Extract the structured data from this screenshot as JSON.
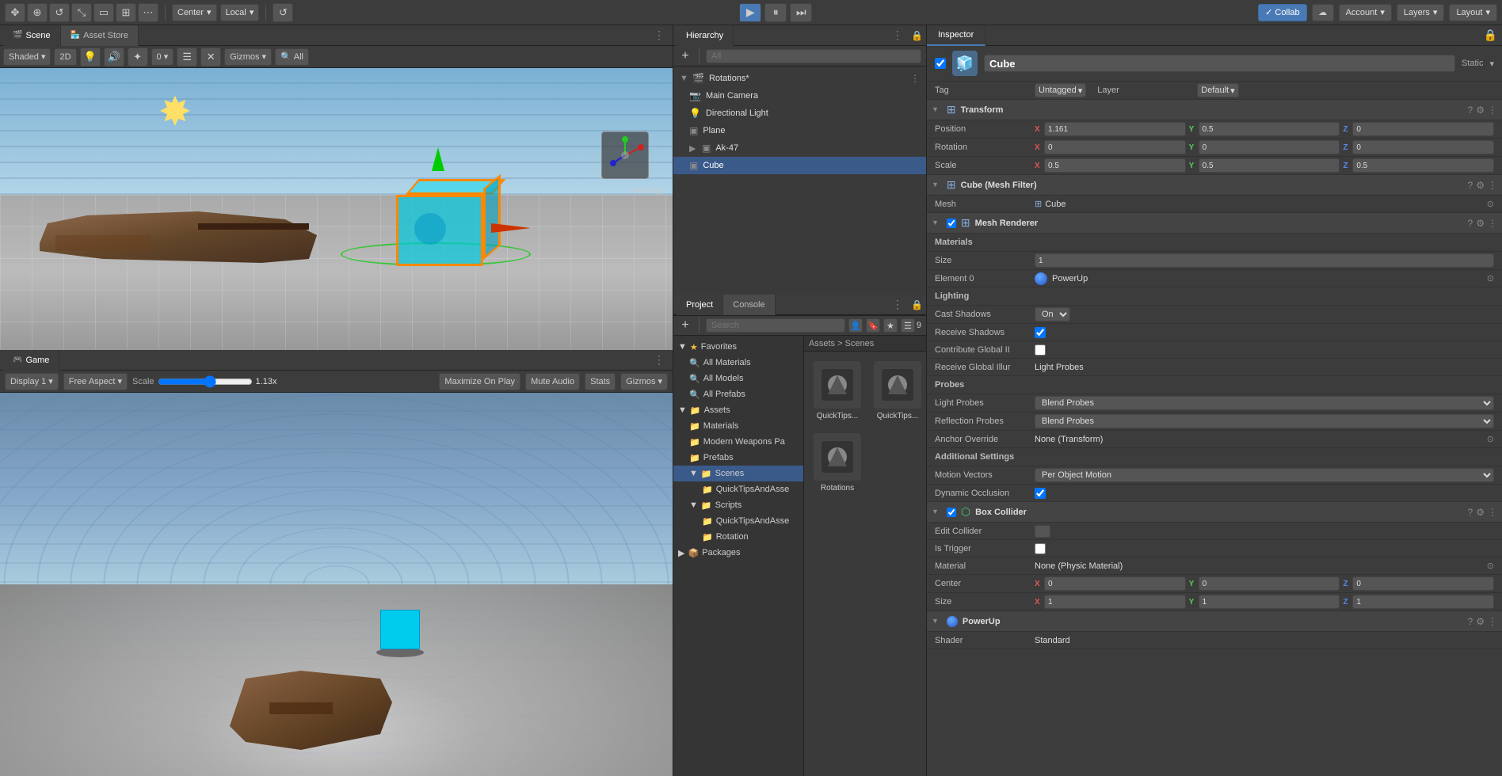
{
  "topbar": {
    "tools": [
      "hand",
      "move",
      "rotate",
      "scale",
      "rect",
      "transform",
      "options"
    ],
    "center_label": "Center",
    "local_label": "Local",
    "play": "▶",
    "pause": "⏸",
    "step": "⏭",
    "collab_label": "✓ Collab",
    "cloud_label": "☁",
    "account_label": "Account",
    "layers_label": "Layers",
    "layout_label": "Layout"
  },
  "scene": {
    "tab_label": "Scene",
    "asset_store_tab": "Asset Store",
    "shaded_label": "Shaded",
    "gizmos_label": "Gizmos",
    "search_label": "All",
    "persp_label": "◄ Persp"
  },
  "game": {
    "tab_label": "Game",
    "display_label": "Display 1",
    "aspect_label": "Free Aspect",
    "scale_label": "Scale",
    "scale_value": "1.13x",
    "maximize_label": "Maximize On Play",
    "mute_label": "Mute Audio",
    "stats_label": "Stats",
    "gizmos_label": "Gizmos"
  },
  "hierarchy": {
    "tab_label": "Hierarchy",
    "scene_name": "Rotations*",
    "all_label": "All",
    "items": [
      {
        "name": "Main Camera",
        "icon": "📷",
        "indent": 1
      },
      {
        "name": "Directional Light",
        "icon": "💡",
        "indent": 1
      },
      {
        "name": "Plane",
        "icon": "▣",
        "indent": 1
      },
      {
        "name": "Ak-47",
        "icon": "▣",
        "indent": 1,
        "has_children": true
      },
      {
        "name": "Cube",
        "icon": "▣",
        "indent": 1,
        "selected": true
      }
    ]
  },
  "project": {
    "project_tab": "Project",
    "console_tab": "Console",
    "favorites": {
      "label": "Favorites",
      "items": [
        "All Materials",
        "All Models",
        "All Prefabs"
      ]
    },
    "assets": {
      "label": "Assets",
      "items": [
        {
          "name": "Materials",
          "type": "folder"
        },
        {
          "name": "Modern Weapons Pa",
          "type": "folder"
        },
        {
          "name": "Prefabs",
          "type": "folder"
        },
        {
          "name": "Scenes",
          "type": "folder",
          "expanded": true,
          "children": [
            {
              "name": "QuickTipsAndAsse",
              "type": "folder"
            }
          ]
        },
        {
          "name": "Scripts",
          "type": "folder",
          "expanded": true,
          "children": [
            {
              "name": "QuickTipsAndAsse",
              "type": "folder"
            },
            {
              "name": "Rotation",
              "type": "folder"
            }
          ]
        },
        {
          "name": "Packages",
          "type": "folder"
        }
      ]
    },
    "breadcrumb": "Assets > Scenes",
    "files": [
      {
        "name": "QuickTips...",
        "icon": "🎬"
      },
      {
        "name": "QuickTips...",
        "icon": "🎬"
      },
      {
        "name": "Rotations",
        "icon": "🎬"
      }
    ]
  },
  "inspector": {
    "tab_label": "Inspector",
    "object_name": "Cube",
    "static_label": "Static",
    "tag_label": "Tag",
    "tag_value": "Untagged",
    "layer_label": "Layer",
    "layer_value": "Default",
    "sections": {
      "transform": {
        "label": "Transform",
        "position": {
          "x": "1.161",
          "y": "0.5",
          "z": "0"
        },
        "rotation": {
          "x": "0",
          "y": "0",
          "z": "0"
        },
        "scale": {
          "x": "0.5",
          "y": "0.5",
          "z": "0.5"
        }
      },
      "mesh_filter": {
        "label": "Cube (Mesh Filter)",
        "mesh_label": "Mesh",
        "mesh_value": "Cube"
      },
      "mesh_renderer": {
        "label": "Mesh Renderer",
        "materials_label": "Materials",
        "size_label": "Size",
        "size_value": "1",
        "element_label": "Element 0",
        "element_value": "PowerUp",
        "lighting_label": "Lighting",
        "cast_shadows_label": "Cast Shadows",
        "cast_shadows_value": "On",
        "receive_shadows_label": "Receive Shadows",
        "contribute_gi_label": "Contribute Global II",
        "receive_gi_label": "Receive Global Illur",
        "receive_gi_value": "Light Probes",
        "probes_label": "Probes",
        "light_probes_label": "Light Probes",
        "light_probes_value": "Blend Probes",
        "reflection_probes_label": "Reflection Probes",
        "reflection_probes_value": "Blend Probes",
        "anchor_override_label": "Anchor Override",
        "anchor_override_value": "None (Transform)",
        "additional_settings_label": "Additional Settings",
        "motion_vectors_label": "Motion Vectors",
        "motion_vectors_value": "Per Object Motion",
        "dynamic_occlusion_label": "Dynamic Occlusion"
      },
      "box_collider": {
        "label": "Box Collider",
        "edit_collider_label": "Edit Collider",
        "is_trigger_label": "Is Trigger",
        "material_label": "Material",
        "material_value": "None (Physic Material)",
        "center_label": "Center",
        "center": {
          "x": "0",
          "y": "0",
          "z": "0"
        },
        "size_label": "Size",
        "size": {
          "x": "1",
          "y": "1",
          "z": "1"
        }
      },
      "powerup": {
        "label": "PowerUp",
        "shader_label": "Shader",
        "shader_value": "Standard"
      }
    }
  }
}
